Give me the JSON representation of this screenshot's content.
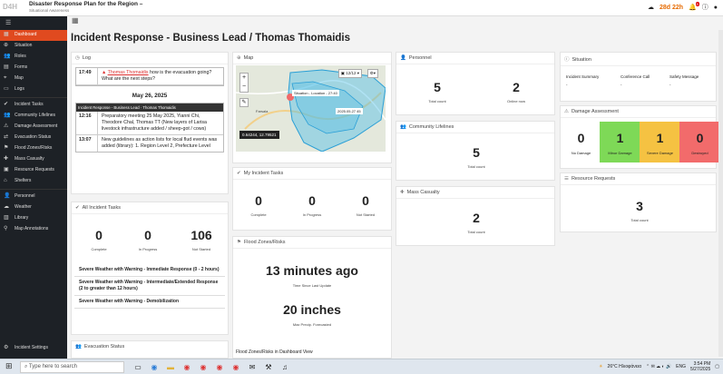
{
  "app": {
    "title": "Disaster Response Plan for the Region –",
    "subtitle": "Situational Awareness",
    "countdown": "28d 22h",
    "notif_count": "9"
  },
  "sidebar": {
    "items": [
      {
        "icon": "grid",
        "label": "Dashboard",
        "active": true
      },
      {
        "icon": "globe",
        "label": "Situation"
      },
      {
        "icon": "users",
        "label": "Roles"
      },
      {
        "icon": "form",
        "label": "Forms"
      },
      {
        "icon": "map",
        "label": "Map"
      },
      {
        "icon": "file",
        "label": "Logs"
      },
      {
        "icon": "check",
        "label": "Incident Tasks"
      },
      {
        "icon": "users",
        "label": "Community Lifelines"
      },
      {
        "icon": "alert",
        "label": "Damage Assessment"
      },
      {
        "icon": "arrow",
        "label": "Evacuation Status"
      },
      {
        "icon": "flag",
        "label": "Flood Zones/Risks"
      },
      {
        "icon": "cross",
        "label": "Mass Casualty"
      },
      {
        "icon": "box",
        "label": "Resource Requests"
      },
      {
        "icon": "home",
        "label": "Shelters"
      },
      {
        "icon": "user",
        "label": "Personnel"
      },
      {
        "icon": "cloud",
        "label": "Weather"
      },
      {
        "icon": "book",
        "label": "Library"
      },
      {
        "icon": "pin",
        "label": "Map Annotations"
      }
    ],
    "settings": "Incident Settings"
  },
  "page": {
    "title": "Incident Response - Business Lead / Thomas Thomaidis"
  },
  "log": {
    "title": "Log",
    "rows": [
      {
        "time": "17:49",
        "author": "Thomas Thomaidis",
        "text": " how is the evacuation going? What are the next steps?"
      }
    ],
    "date": "May 26, 2025",
    "section": "Incident Response - Business Lead · Thomas Thomaidis",
    "entries": [
      {
        "time": "12:16",
        "text": "Preparatory meeting 25 May 2025, Yianni Chi, Theodore Chal, Thomas TT (New layers of Larisa livestock infrastructure added / sheep-got / cows)"
      },
      {
        "time": "13:07",
        "text": "New guidelines as action lists for local flud events was added (library): 1. Region Level 2, Prefecture Level"
      }
    ]
  },
  "alltasks": {
    "title": "All Incident Tasks",
    "complete": "0",
    "complete_l": "Complete",
    "progress": "0",
    "progress_l": "In Progress",
    "notstarted": "106",
    "notstarted_l": "Not Started",
    "items": [
      "Severe Weather with Warning - Immediate Response (0 - 2 hours)",
      "Severe Weather with Warning - Intermediate/Extended Response (2 to greater than 12 hours)",
      "Severe Weather with Warning - Demobilization"
    ]
  },
  "evac": {
    "title": "Evacuation Status"
  },
  "map": {
    "title": "Map",
    "label1": "Situation - Location - 27:40",
    "label2": "2025.05.27 45",
    "coords": "0.64244, 12.79521",
    "zoom": "12/12",
    "town": "Farsala"
  },
  "mytasks": {
    "title": "My Incident Tasks",
    "complete": "0",
    "complete_l": "Complete",
    "progress": "0",
    "progress_l": "In Progress",
    "notstarted": "0",
    "notstarted_l": "Not Started"
  },
  "flood": {
    "title": "Flood Zones/Risks",
    "time": "13 minutes ago",
    "time_l": "Time Since Last Update",
    "inches": "20 inches",
    "inches_l": "Max Precip. Forecasted",
    "footer": "Flood Zones/Risks in Dashboard View"
  },
  "personnel": {
    "title": "Personnel",
    "total": "5",
    "total_l": "Total count",
    "online": "2",
    "online_l": "Online now"
  },
  "lifelines": {
    "title": "Community Lifelines",
    "total": "5",
    "total_l": "Total count"
  },
  "casualty": {
    "title": "Mass Casualty",
    "total": "2",
    "total_l": "Total count"
  },
  "situation": {
    "title": "Situation",
    "c1": "Incident Summary",
    "c2": "Conference Call",
    "c3": "Safety Message",
    "v": "-"
  },
  "damage": {
    "title": "Damage Assessment",
    "items": [
      {
        "n": "0",
        "l": "No Damage",
        "color": "#ffffff"
      },
      {
        "n": "1",
        "l": "Minor Damage",
        "color": "#7ed957"
      },
      {
        "n": "1",
        "l": "Severe Damage",
        "color": "#f5c242"
      },
      {
        "n": "0",
        "l": "Destroyed",
        "color": "#f26b6b"
      }
    ]
  },
  "resources": {
    "title": "Resource Requests",
    "total": "3",
    "total_l": "Total count"
  },
  "taskbar": {
    "search": "Type here to search",
    "weather": "26°C Ηλιοφάνεια",
    "lang": "ENG",
    "time": "3:54 PM",
    "date": "5/27/2025"
  }
}
